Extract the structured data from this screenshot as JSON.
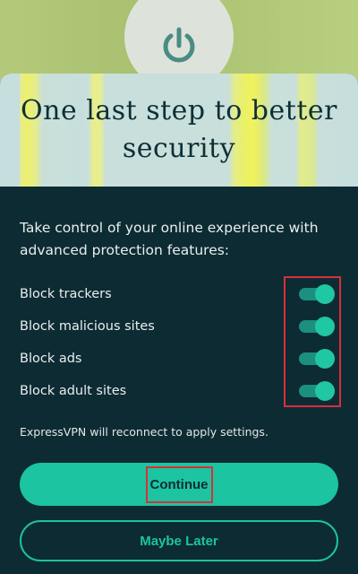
{
  "header": {
    "title": "One last step to better security",
    "icon": "power-icon"
  },
  "intro_text": "Take control of your online experience with advanced protection features:",
  "toggles": [
    {
      "label": "Block trackers",
      "enabled": true
    },
    {
      "label": "Block malicious sites",
      "enabled": true
    },
    {
      "label": "Block ads",
      "enabled": true
    },
    {
      "label": "Block adult sites",
      "enabled": true
    }
  ],
  "note": "ExpressVPN will reconnect to apply settings.",
  "buttons": {
    "continue_label": "Continue",
    "maybe_later_label": "Maybe Later"
  },
  "colors": {
    "sheet_background": "#0d2b33",
    "accent": "#1cc4a1",
    "highlight": "#d8303a"
  }
}
